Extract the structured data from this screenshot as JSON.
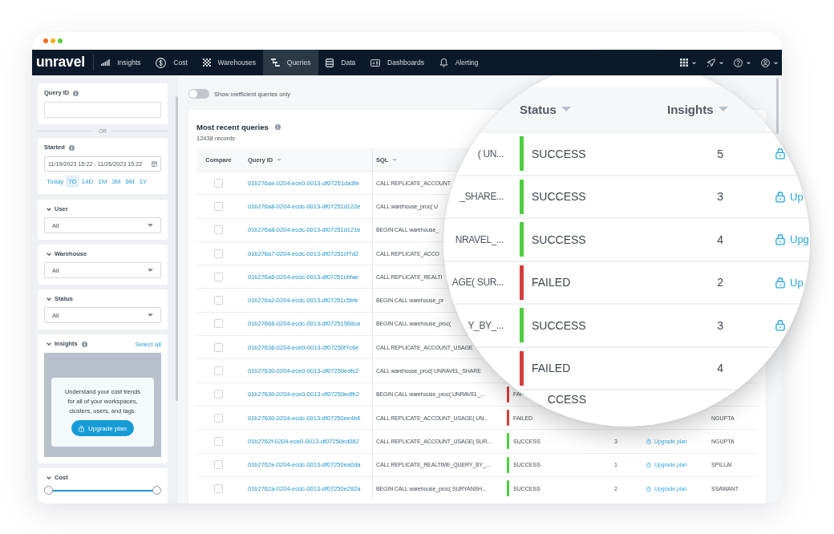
{
  "window": {
    "controls": [
      {
        "color": "#f26a1b"
      },
      {
        "color": "#f9b015"
      },
      {
        "color": "#58cf32"
      }
    ]
  },
  "nav": {
    "logo": "unravel",
    "items": [
      {
        "label": "Insights",
        "selected": false
      },
      {
        "label": "Cost",
        "selected": false
      },
      {
        "label": "Warehouses",
        "selected": false
      },
      {
        "label": "Queries",
        "selected": true
      },
      {
        "label": "Data",
        "selected": false
      },
      {
        "label": "Dashboards",
        "selected": false
      },
      {
        "label": "Alerting",
        "selected": false
      }
    ]
  },
  "filters": {
    "query_id": {
      "label": "Query ID",
      "info": true
    },
    "separator": "OR",
    "started": {
      "label": "Started",
      "info": true,
      "value": "11/19/2023 15:22 - 11/26/2023 15:22",
      "ranges": [
        {
          "label": "Today",
          "selected": false
        },
        {
          "label": "7D",
          "selected": true
        },
        {
          "label": "14D",
          "selected": false
        },
        {
          "label": "1M",
          "selected": false
        },
        {
          "label": "3M",
          "selected": false
        },
        {
          "label": "6M",
          "selected": false
        },
        {
          "label": "1Y",
          "selected": false
        }
      ]
    },
    "selects": [
      {
        "label": "User",
        "expanded": true,
        "value": "All"
      },
      {
        "label": "Warehouse",
        "expanded": true,
        "value": "All"
      },
      {
        "label": "Status",
        "expanded": true,
        "value": "All"
      }
    ],
    "insights": {
      "label": "Insights",
      "info": true,
      "expanded": true,
      "action": "Select all",
      "upsell": {
        "text": "Understand your cost trends for all of your workspaces, clusters, users, and tags.",
        "button": "Upgrade plan"
      }
    },
    "cost": {
      "label": "Cost",
      "expanded": true,
      "thumbs": [
        {
          "level": 0
        },
        {
          "level": 1
        }
      ]
    }
  },
  "toggle": {
    "label": "Show inefficient queries only",
    "on": false
  },
  "table": {
    "title": "Most recent queries",
    "info": true,
    "count": "12438 records",
    "columns": [
      {
        "label": "Compare",
        "sortable": false
      },
      {
        "label": "Query ID",
        "sortable": true
      },
      {
        "label": "SQL",
        "sortable": true
      }
    ],
    "rows": [
      {
        "checked": false,
        "query_id": "01b276ae-0204-ece0-0013-df07251da3fe",
        "sql": "CALL REPLICATE_ACCOUNT"
      },
      {
        "checked": false,
        "query_id": "01b276a8-0204-ecdc-0013-df07251d122e",
        "sql": "CALL warehouse_proc( U"
      },
      {
        "checked": false,
        "query_id": "01b276a8-0204-ecdc-0013-df07251d121e",
        "sql": "BEGIN CALL warehouse_"
      },
      {
        "checked": false,
        "query_id": "01b276a7-0204-ecdc-0013-df07251cf7d2",
        "sql": "CALL REPLICATE_ACCO"
      },
      {
        "checked": false,
        "query_id": "01b276a6-0204-ecdc-0013-df07251cbfae",
        "sql": "CALL REPLICATE_REALTI"
      },
      {
        "checked": false,
        "query_id": "01b276a2-0204-ecdc-0013-df07251c5bfe",
        "sql": "BEGIN CALL warehouse_pr"
      },
      {
        "checked": false,
        "query_id": "01b27666-0204-ecdc-0013-df07251568ca",
        "sql": "BEGIN CALL warehouse_proc("
      },
      {
        "checked": false,
        "query_id": "01b27636-0204-ece0-0013-df07250f7c6e",
        "sql": "CALL REPLICATE_ACCOUNT_USAGE"
      },
      {
        "checked": false,
        "query_id": "01b27630-0204-ece0-0013-df07250edfc2",
        "sql": "CALL warehouse_proc( UNRAVEL_SHARE"
      },
      {
        "checked": false,
        "query_id": "01b27630-0204-ece0-0013-df07250edfb2",
        "sql": "BEGIN CALL warehouse_proc( UNRAVEL_...",
        "status": {
          "kind": "failed",
          "text": "FAI"
        }
      },
      {
        "checked": false,
        "query_id": "01b27630-0204-ecdc-0013-df07250ee4b6",
        "sql": "CALL REPLICATE_ACCOUNT_USAGE( UN...",
        "status": {
          "kind": "failed",
          "text": "FAILED"
        },
        "user": "NGUPTA"
      },
      {
        "checked": false,
        "query_id": "01b2762f-0204-ece0-0013-df07250ed062",
        "sql": "CALL REPLICATE_ACCOUNT_USAGE( SUR...",
        "status": {
          "kind": "success",
          "text": "SUCCESS"
        },
        "insights": "3",
        "upgrade": "Upgrade plan",
        "user": "NGUPTA"
      },
      {
        "checked": false,
        "query_id": "01b2762e-0204-ecdc-0013-df07250ea0da",
        "sql": "CALL REPLICATE_REALTIME_QUERY_BY_...",
        "status": {
          "kind": "success",
          "text": "SUCCESS"
        },
        "insights": "1",
        "upgrade": "Upgrade plan",
        "user": "SPILLAI"
      },
      {
        "checked": false,
        "query_id": "01b2762a-0204-ecdc-0013-df07250e282a",
        "sql": "BEGIN CALL warehouse_proc( SURYANSH...",
        "status": {
          "kind": "success",
          "text": "SUCCESS"
        },
        "insights": "2",
        "upgrade": "Upgrade plan",
        "user": "SSAWANT"
      }
    ]
  },
  "magnifier": {
    "columns": [
      {
        "label": "Status",
        "sortable": true
      },
      {
        "label": "Insights",
        "sortable": true
      }
    ],
    "rows": [
      {
        "sql": "( UN...",
        "status": {
          "kind": "success",
          "text": "SUCCESS"
        },
        "insights": "5",
        "locked": true
      },
      {
        "sql": "_SHARE...",
        "status": {
          "kind": "success",
          "text": "SUCCESS"
        },
        "insights": "3",
        "locked": true,
        "upgrade": "Up"
      },
      {
        "sql": "NRAVEL_...",
        "status": {
          "kind": "success",
          "text": "SUCCESS"
        },
        "insights": "4",
        "locked": true,
        "upgrade": "Upg"
      },
      {
        "sql": "AGE( SUR...",
        "status": {
          "kind": "failed",
          "text": "FAILED"
        },
        "insights": "2",
        "locked": true,
        "upgrade": "Up"
      },
      {
        "sql": "Y_BY_...",
        "status": {
          "kind": "success",
          "text": "SUCCESS"
        },
        "insights": "3",
        "locked": true
      },
      {
        "status": {
          "kind": "failed",
          "text": "FAILED"
        },
        "insights": "4"
      },
      {
        "status": {
          "kind": "success",
          "text": "CCESS",
          "clipped": true
        }
      }
    ]
  }
}
